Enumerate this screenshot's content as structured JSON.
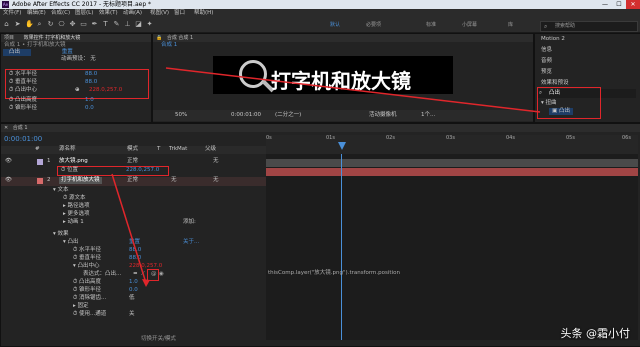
{
  "window": {
    "logo": "Ae",
    "title": "Adobe After Effects CC 2017 - 无标题项目.aep *",
    "min": "—",
    "max": "☐",
    "close": "✕"
  },
  "menu": [
    "文件(F)",
    "编辑(E)",
    "合成(C)",
    "图层(L)",
    "效果(T)",
    "动画(A)",
    "视图(V)",
    "窗口",
    "帮助(H)"
  ],
  "workspaces": [
    "默认",
    "必要项",
    "标准",
    "小屏幕",
    "库"
  ],
  "search_placeholder": "搜索帮助",
  "effect_controls": {
    "tab_project": "项目",
    "tab_effects": "效果控件 打字机和放大镜",
    "breadcrumb": "合成 1 • 打字机和放大镜",
    "effect_name": "凸出",
    "reset": "重置",
    "anim_preset_label": "动画预设：",
    "anim_preset_value": "无",
    "props": [
      {
        "name": "水平半径",
        "value": "88.0"
      },
      {
        "name": "垂直半径",
        "value": "88.0"
      },
      {
        "name": "凸出中心",
        "value": "228.0,257.0"
      },
      {
        "name": "凸出高度",
        "value": "1.0"
      },
      {
        "name": "锥形半径",
        "value": "0.0"
      }
    ]
  },
  "composition": {
    "tab": "合成 合成 1",
    "subtab": "合成 1",
    "display_text": "打字机和放大镜",
    "zoom": "50%",
    "timecode": "0:00:01:00",
    "resolution": "(二分之一)",
    "camera": "活动摄像机",
    "views": "1个..."
  },
  "right_panel": {
    "items": [
      "Motion 2",
      "信息",
      "音频",
      "预览"
    ],
    "effects_presets_title": "效果和预设",
    "search_value": "凸出",
    "category": "扭曲",
    "result": "凸出"
  },
  "timeline": {
    "tab": "合成 1",
    "timecode": "0:00:01:00",
    "col_headers": [
      "#",
      "源名称",
      "模式",
      "T",
      "TrkMat",
      "父级"
    ],
    "ruler": [
      "0s",
      "01s",
      "02s",
      "03s",
      "04s",
      "05s",
      "06s"
    ],
    "layers": [
      {
        "num": "1",
        "name": "放大镜.png",
        "mode": "正常",
        "parent": "无",
        "color": "#b3a6d6"
      },
      {
        "num": "2",
        "name": "打字机和放大镜",
        "mode": "正常",
        "trkmat": "无",
        "parent": "无",
        "color": "#d86a6a"
      }
    ],
    "position_prop": {
      "name": "位置",
      "value": "228.0,257.0"
    },
    "tree": [
      {
        "label": "文本",
        "value": "",
        "indent": 1,
        "expanded": true
      },
      {
        "label": "源文本",
        "value": "",
        "indent": 2
      },
      {
        "label": "路径选项",
        "value": "",
        "indent": 2,
        "expanded": false
      },
      {
        "label": "更多选项",
        "value": "",
        "indent": 2,
        "expanded": false
      },
      {
        "label": "动画 1",
        "value": "添加:",
        "indent": 2,
        "expanded": false
      },
      {
        "label": "效果",
        "value": "",
        "indent": 1,
        "expanded": true
      },
      {
        "label": "凸出",
        "value": "重置",
        "value2": "关于...",
        "indent": 2,
        "expanded": true
      },
      {
        "label": "水平半径",
        "value": "88.0",
        "indent": 3
      },
      {
        "label": "垂直半径",
        "value": "88.0",
        "indent": 3
      },
      {
        "label": "凸出中心",
        "value": "228.0,257.0",
        "indent": 3,
        "expanded": true
      },
      {
        "label": "表达式：凸出...",
        "value": "",
        "indent": 4
      },
      {
        "label": "凸出高度",
        "value": "1.0",
        "indent": 3
      },
      {
        "label": "锥形半径",
        "value": "0.0",
        "indent": 3
      },
      {
        "label": "消除锯齿...",
        "value": "低",
        "indent": 3
      },
      {
        "label": "固定",
        "value": "",
        "indent": 3,
        "expanded": false
      },
      {
        "label": "使用...通道",
        "value": "关",
        "indent": 3
      }
    ],
    "expression": "thisComp.layer(\"放大镜.png\").transform.position",
    "footer": "切换开关/模式"
  },
  "watermark": "头条 @霜小付",
  "colors": {
    "accent": "#4a90d9",
    "highlight": "#e0262b",
    "layer_bar": "#a14545"
  }
}
